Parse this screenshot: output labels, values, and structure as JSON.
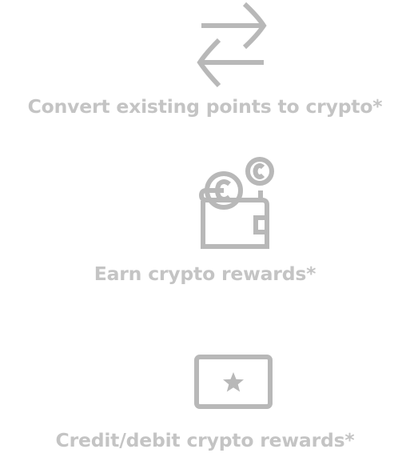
{
  "features": [
    {
      "icon": "convert-arrows-icon",
      "label": "Convert existing points to crypto*"
    },
    {
      "icon": "wallet-coins-icon",
      "label": "Earn crypto rewards*"
    },
    {
      "icon": "star-card-icon",
      "label": "Credit/debit crypto rewards*"
    }
  ],
  "colors": {
    "icon": "#b8b8b8",
    "text": "#c4c4c4",
    "background": "#ffffff"
  }
}
